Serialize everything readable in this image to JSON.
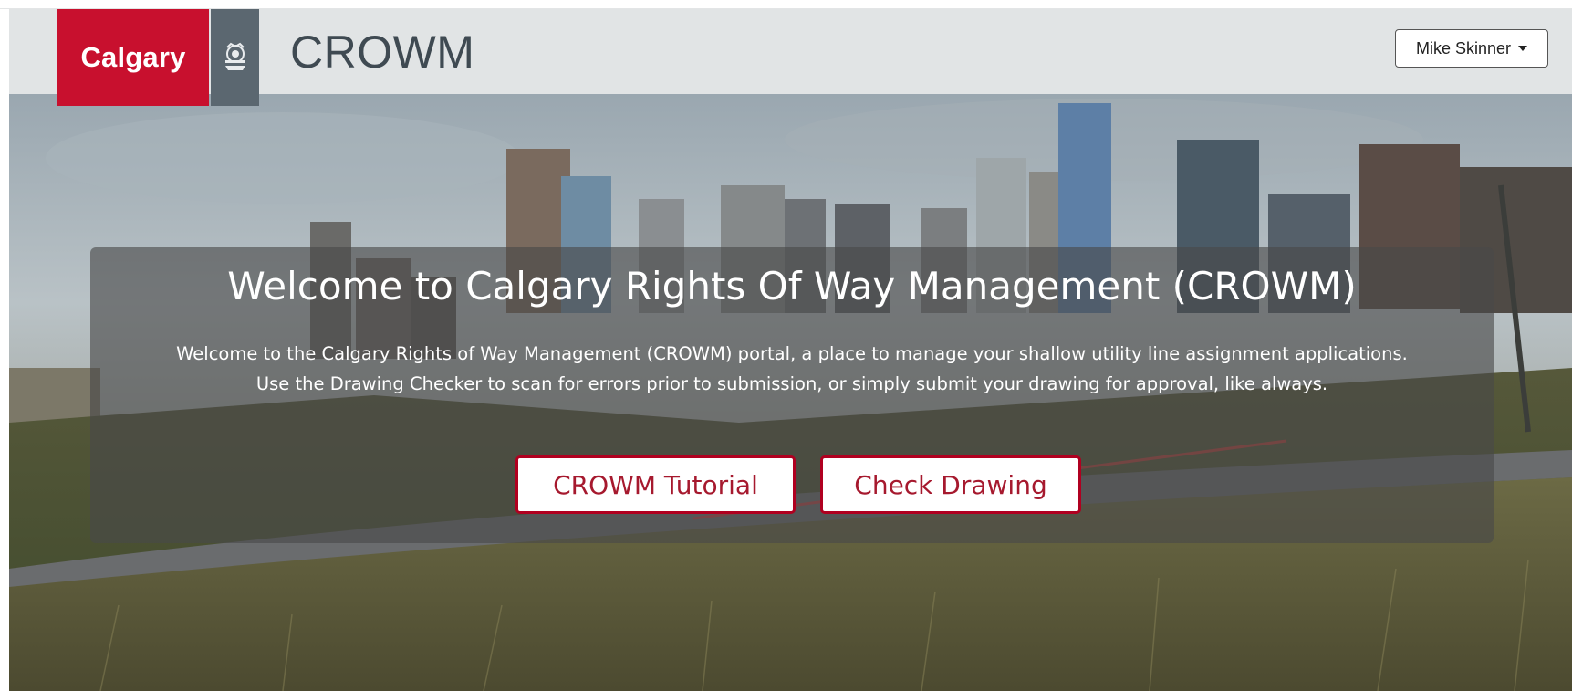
{
  "header": {
    "logo_text": "Calgary",
    "app_title": "CROWM",
    "user_menu_label": "Mike Skinner"
  },
  "hero": {
    "title": "Welcome to Calgary Rights Of Way Management (CROWM)",
    "body_line1": "Welcome to the Calgary Rights of Way Management (CROWM) portal, a place to manage your shallow utility line assignment applications.",
    "body_line2": "Use the Drawing Checker to scan for errors prior to submission, or simply submit your drawing for approval, like always.",
    "buttons": {
      "tutorial": "CROWM Tutorial",
      "check_drawing": "Check Drawing"
    }
  },
  "colors": {
    "brand_red": "#c8102e",
    "crest_grey": "#5b6770",
    "header_bg": "#e1e4e5",
    "button_text": "#a6192e"
  },
  "icons": {
    "crest": "city-crest-icon",
    "user_caret": "caret-down-icon"
  }
}
